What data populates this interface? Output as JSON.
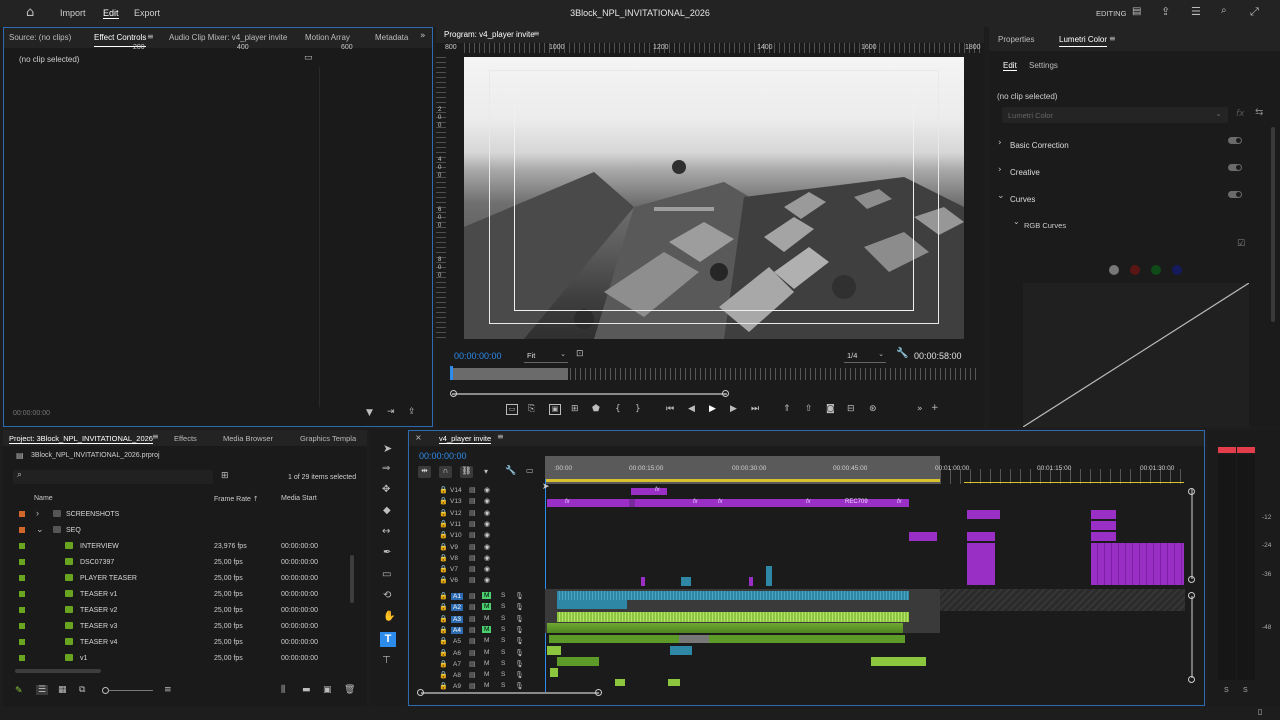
{
  "menubar": {
    "import": "Import",
    "edit": "Edit",
    "export": "Export",
    "title": "3Block_NPL_INVITATIONAL_2026",
    "workspace": "EDITING"
  },
  "source_panel": {
    "tabs": [
      "Source: (no clips)",
      "Effect Controls",
      "Audio Clip Mixer: v4_player invite",
      "Motion Array",
      "Metadata"
    ],
    "no_clip": "(no clip selected)",
    "timecode": "00:00:00:00"
  },
  "program_monitor": {
    "tab": "Program: v4_player invite",
    "ruler_labels": [
      "200",
      "400",
      "600",
      "800",
      "1000",
      "1200",
      "1400",
      "1600",
      "1800"
    ],
    "vruler_labels": [
      "2",
      "0",
      "0",
      "4",
      "0",
      "0",
      "6",
      "0",
      "0",
      "8",
      "0",
      "0"
    ],
    "timecode": "00:00:00:00",
    "fit": "Fit",
    "resolution": "1/4",
    "duration": "00:00:58:00"
  },
  "lumetri": {
    "tabs": [
      "Properties",
      "Lumetri Color"
    ],
    "subtabs": [
      "Edit",
      "Settings"
    ],
    "no_clip": "(no clip selected)",
    "dropdown": "Lumetri Color",
    "sections": [
      "Basic Correction",
      "Creative",
      "Curves"
    ],
    "subsection": "RGB Curves",
    "curve_dot_colors": [
      "#777777",
      "#5a1515",
      "#0f4a18",
      "#141a5c"
    ]
  },
  "project_panel": {
    "tabs": [
      "Project: 3Block_NPL_INVITATIONAL_2026",
      "Effects",
      "Media Browser",
      "Graphics Templa"
    ],
    "file": "3Block_NPL_INVITATIONAL_2026.prproj",
    "items_selected": "1 of 29 items selected",
    "columns": [
      "Name",
      "Frame Rate",
      "Media Start"
    ],
    "rows": [
      {
        "name": "SCREENSHOTS",
        "rate": "",
        "start": "",
        "color": "#d0662a",
        "kind": "folder",
        "indent": 0,
        "expand": "›"
      },
      {
        "name": "SEQ",
        "rate": "",
        "start": "",
        "color": "#d0662a",
        "kind": "folder",
        "indent": 0,
        "expand": "⌄"
      },
      {
        "name": "INTERVIEW",
        "rate": "23,976 fps",
        "start": "00:00:00:00",
        "color": "#6aa521",
        "kind": "seq",
        "indent": 1,
        "expand": ""
      },
      {
        "name": "DSC07397",
        "rate": "25,00 fps",
        "start": "00:00:00:00",
        "color": "#6aa521",
        "kind": "seq",
        "indent": 1,
        "expand": ""
      },
      {
        "name": "PLAYER TEASER",
        "rate": "25,00 fps",
        "start": "00:00:00:00",
        "color": "#6aa521",
        "kind": "seq",
        "indent": 1,
        "expand": ""
      },
      {
        "name": "TEASER v1",
        "rate": "25,00 fps",
        "start": "00:00:00:00",
        "color": "#6aa521",
        "kind": "seq",
        "indent": 1,
        "expand": ""
      },
      {
        "name": "TEASER v2",
        "rate": "25,00 fps",
        "start": "00:00:00:00",
        "color": "#6aa521",
        "kind": "seq",
        "indent": 1,
        "expand": ""
      },
      {
        "name": "TEASER v3",
        "rate": "25,00 fps",
        "start": "00:00:00:00",
        "color": "#6aa521",
        "kind": "seq",
        "indent": 1,
        "expand": ""
      },
      {
        "name": "TEASER v4",
        "rate": "25,00 fps",
        "start": "00:00:00:00",
        "color": "#6aa521",
        "kind": "seq",
        "indent": 1,
        "expand": ""
      },
      {
        "name": "v1",
        "rate": "25,00 fps",
        "start": "00:00:00:00",
        "color": "#6aa521",
        "kind": "seq",
        "indent": 1,
        "expand": ""
      }
    ]
  },
  "timeline": {
    "tab": "v4_player invite",
    "timecode": "00:00:00:00",
    "ruler_labels": [
      ":00:00",
      "00:00:15:00",
      "00:00:30:00",
      "00:00:45:00",
      "00:01:00:00",
      "00:01:15:00",
      "00:01:30:00"
    ],
    "video_tracks": [
      "V14",
      "V13",
      "V12",
      "V11",
      "V10",
      "V9",
      "V8",
      "V7",
      "V6"
    ],
    "audio_tracks": [
      "A1",
      "A2",
      "A3",
      "A4",
      "A5",
      "A6",
      "A7",
      "A8",
      "A9"
    ],
    "clip_label": "REC709",
    "fx_label": "fx"
  },
  "audio_meter": {
    "labels": [
      "-12",
      "-24",
      "-36",
      "-48"
    ],
    "solo": [
      "S",
      "S"
    ]
  },
  "colors": {
    "accent_blue": "#2d8ceb",
    "clip_purple": "#9a2fc6",
    "audio_green": "#8cc63f",
    "audio_teal": "#2f87a6",
    "label_orange": "#d0662a",
    "label_green": "#6aa521",
    "meter_red": "#e33c4a"
  }
}
